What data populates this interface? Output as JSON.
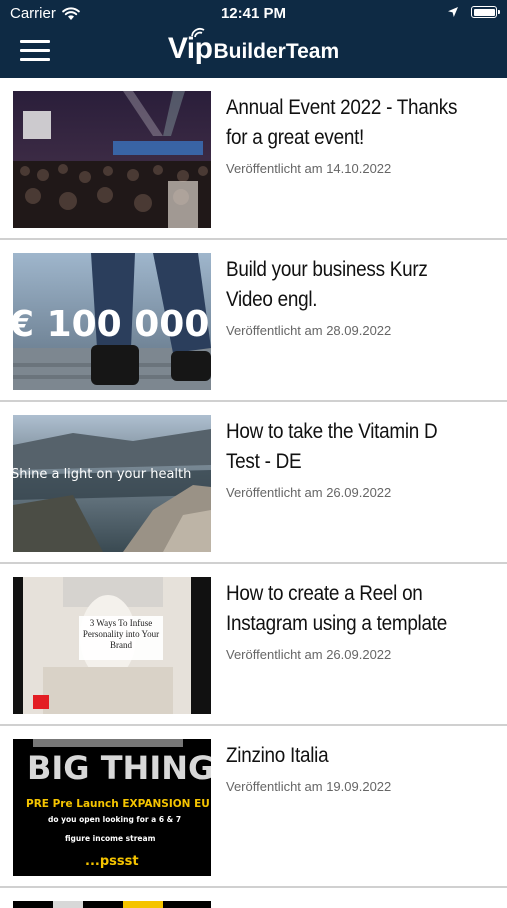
{
  "status_bar": {
    "carrier": "Carrier",
    "time": "12:41 PM"
  },
  "header": {
    "logo_vip": "Vip",
    "logo_rest": "BuilderTeam",
    "menu_icon": "hamburger-menu-icon"
  },
  "videos": [
    {
      "title": "Annual Event 2022 - Thanks for a great event!",
      "date": "Veröffentlicht am 14.10.2022"
    },
    {
      "title": "Build your business Kurz Video engl.",
      "date": "Veröffentlicht am 28.09.2022",
      "thumb_text": "€ 100 000"
    },
    {
      "title": "How to take the Vitamin D Test - DE",
      "date": "Veröffentlicht am 26.09.2022",
      "thumb_text": "Shine a light on your health"
    },
    {
      "title": "How to create a Reel on Instagram using a template",
      "date": "Veröffentlicht am 26.09.2022",
      "thumb_text": "3 Ways To Infuse Personality into Your Brand"
    },
    {
      "title": "Zinzino Italia",
      "date": "Veröffentlicht am 19.09.2022",
      "thumb_text_1": "BIG THING",
      "thumb_text_2": "PRE Pre Launch EXPANSION EU",
      "thumb_text_3": "do you open looking for a 6 & 7",
      "thumb_text_4": "figure income stream",
      "thumb_text_5": "...pssst"
    }
  ],
  "colors": {
    "header_bg": "#0e2a44",
    "divider": "#d0d0d0",
    "date_text": "#666666"
  }
}
